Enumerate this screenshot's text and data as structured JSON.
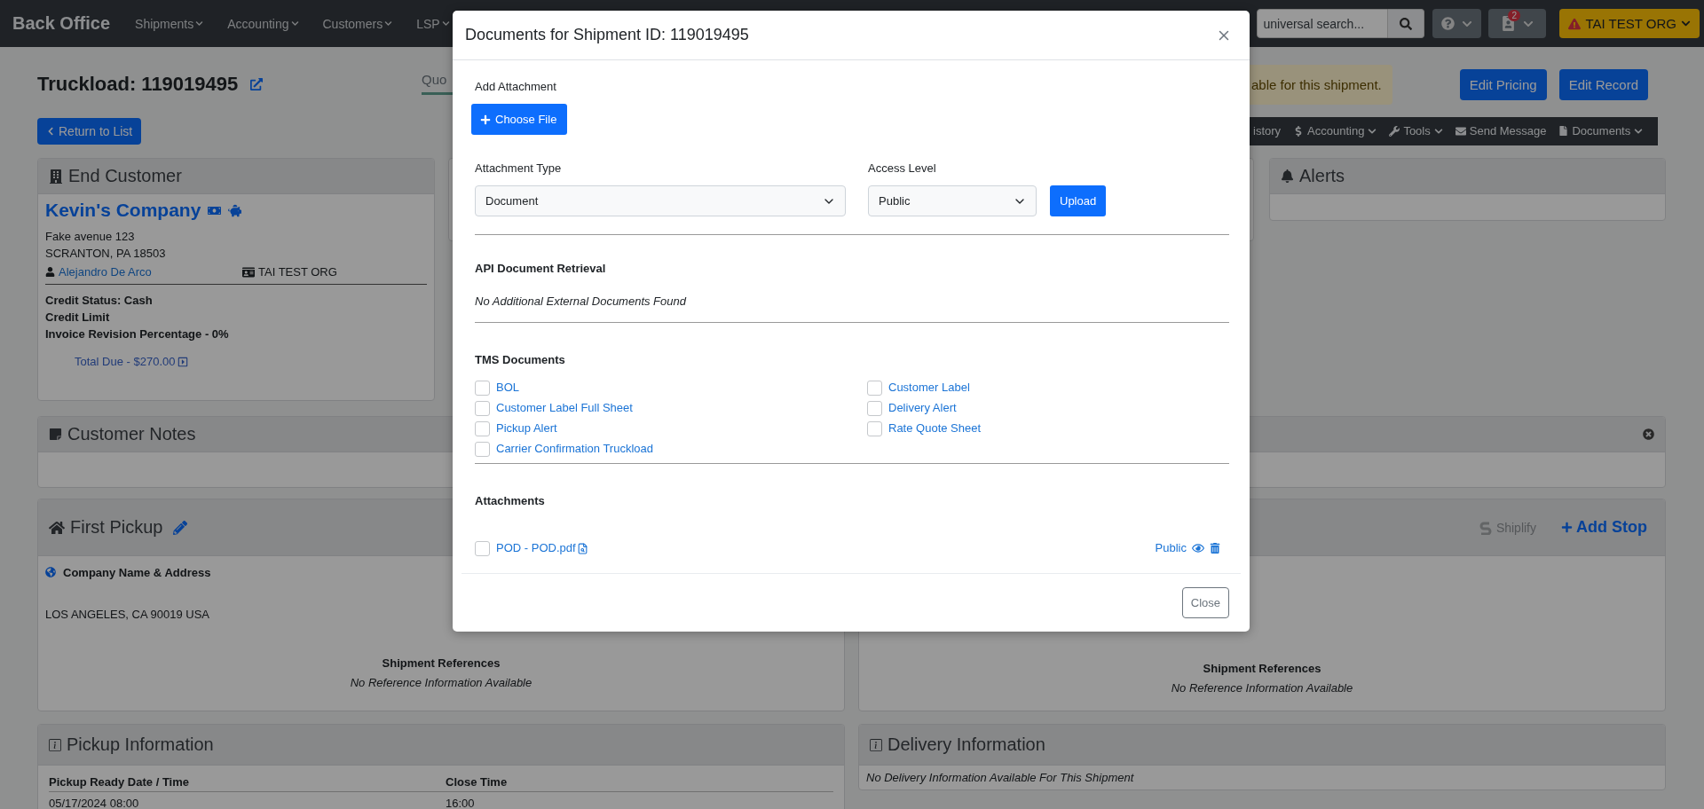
{
  "navbar": {
    "brand": "Back Office",
    "menus": [
      {
        "label": "Shipments",
        "dropdown": true
      },
      {
        "label": "Accounting",
        "dropdown": true
      },
      {
        "label": "Customers",
        "dropdown": true
      },
      {
        "label": "LSP",
        "dropdown": true
      }
    ],
    "search_placeholder": "universal search...",
    "notification_count": "2",
    "org_label": "TAI TEST ORG"
  },
  "header": {
    "title": "Truckload: 119019495",
    "tab": {
      "label": "Quo",
      "selected": true
    },
    "alert": "able for this shipment.",
    "buttons": [
      "Edit Pricing",
      "Edit Record"
    ]
  },
  "return_button": "Return to List",
  "toolbar": [
    {
      "label": "istory",
      "kind": "plain",
      "dropdown": false
    },
    {
      "label": "Accounting",
      "kind": "dollar",
      "dropdown": true
    },
    {
      "label": "Tools",
      "kind": "wrench",
      "dropdown": true
    },
    {
      "label": "Send Message",
      "kind": "envelope",
      "dropdown": false
    },
    {
      "label": "Documents",
      "kind": "file",
      "dropdown": true
    }
  ],
  "end_customer": {
    "title": "End Customer",
    "company": "Kevin's Company",
    "address": [
      "Fake avenue 123",
      "SCRANTON, PA 18503"
    ],
    "contact": "Alejandro De Arco",
    "organization": "TAI TEST ORG",
    "credit_lines": [
      "Credit Status: Cash",
      "Credit Limit",
      "Invoice Revision Percentage - 0%"
    ],
    "total_due": "Total Due - $270.00"
  },
  "alerts": {
    "title": "Alerts"
  },
  "customer_notes": {
    "title": "Customer Notes"
  },
  "first_pickup": {
    "title": "First Pickup",
    "company_label": "Company Name & Address",
    "address": "LOS ANGELES, CA 90019 USA",
    "references_title": "Shipment References",
    "references_empty": "No Reference Information Available"
  },
  "delivery_stop": {
    "shiplify": "Shiplify",
    "add_stop": "Add Stop",
    "references_title": "Shipment References",
    "references_empty": "No Reference Information Available"
  },
  "pickup_information": {
    "title": "Pickup Information",
    "columns": [
      "Pickup Ready Date / Time",
      "Close Time"
    ],
    "rows": [
      [
        "05/17/2024 08:00",
        "16:00"
      ]
    ]
  },
  "delivery_information": {
    "title": "Delivery Information",
    "empty": "No Delivery Information Available For This Shipment"
  },
  "modal": {
    "title": "Documents for Shipment ID: 119019495",
    "add_attachment_label": "Add Attachment",
    "choose_file": "Choose File",
    "attachment_type": {
      "label": "Attachment Type",
      "value": "Document"
    },
    "access_level": {
      "label": "Access Level",
      "value": "Public"
    },
    "upload": "Upload",
    "api_title": "API Document Retrieval",
    "api_empty": "No Additional External Documents Found",
    "tms_title": "TMS Documents",
    "tms_documents": [
      {
        "label": "BOL",
        "checked": false
      },
      {
        "label": "Customer Label",
        "checked": false
      },
      {
        "label": "Customer Label Full Sheet",
        "checked": false
      },
      {
        "label": "Delivery Alert",
        "checked": false
      },
      {
        "label": "Pickup Alert",
        "checked": false
      },
      {
        "label": "Rate Quote Sheet",
        "checked": false
      },
      {
        "label": "Carrier Confirmation Truckload",
        "checked": false
      }
    ],
    "attachments_title": "Attachments",
    "attachments": [
      {
        "name": "POD - POD.pdf",
        "access": "Public",
        "checked": false
      }
    ],
    "close": "Close"
  }
}
